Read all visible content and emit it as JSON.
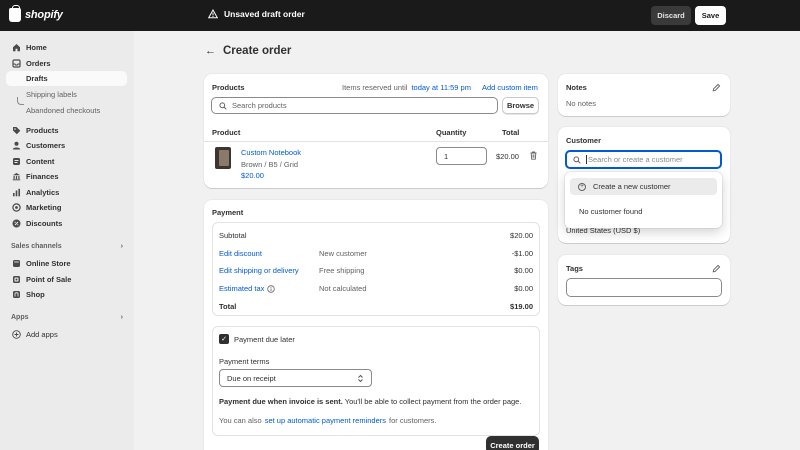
{
  "topbar": {
    "brand": "shopify",
    "status": "Unsaved draft order",
    "discard_label": "Discard",
    "save_label": "Save"
  },
  "sidebar": {
    "items": [
      {
        "label": "Home",
        "icon": "home-icon"
      },
      {
        "label": "Orders",
        "icon": "orders-icon"
      },
      {
        "label": "Products",
        "icon": "tag-icon"
      },
      {
        "label": "Customers",
        "icon": "person-icon"
      },
      {
        "label": "Content",
        "icon": "content-icon"
      },
      {
        "label": "Finances",
        "icon": "bank-icon"
      },
      {
        "label": "Analytics",
        "icon": "chart-icon"
      },
      {
        "label": "Marketing",
        "icon": "target-icon"
      },
      {
        "label": "Discounts",
        "icon": "discount-icon"
      }
    ],
    "orders_sub": [
      "Drafts",
      "Shipping labels",
      "Abandoned checkouts"
    ],
    "sales_channels_label": "Sales channels",
    "channels": [
      {
        "label": "Online Store",
        "icon": "store-icon"
      },
      {
        "label": "Point of Sale",
        "icon": "pos-icon"
      },
      {
        "label": "Shop",
        "icon": "shop-icon"
      }
    ],
    "apps_label": "Apps",
    "add_apps_label": "Add apps"
  },
  "page": {
    "title": "Create order"
  },
  "products": {
    "title": "Products",
    "reserved_prefix": "Items reserved until",
    "reserved_link": "today at 11:59 pm",
    "add_custom": "Add custom item",
    "search_placeholder": "Search products",
    "browse_label": "Browse",
    "col_product": "Product",
    "col_quantity": "Quantity",
    "col_total": "Total",
    "line": {
      "name": "Custom Notebook",
      "variant": "Brown / B5 / Grid",
      "price": "$20.00",
      "quantity": "1",
      "total": "$20.00"
    }
  },
  "payment": {
    "title": "Payment",
    "rows": [
      {
        "label": "Subtotal",
        "note": "",
        "value": "$20.00"
      },
      {
        "label": "Edit discount",
        "note": "New customer",
        "value": "-$1.00"
      },
      {
        "label": "Edit shipping or delivery",
        "note": "Free shipping",
        "value": "$0.00"
      },
      {
        "label": "Estimated tax",
        "note": "Not calculated",
        "value": "$0.00"
      },
      {
        "label": "Total",
        "note": "",
        "value": "$19.00"
      }
    ],
    "due_later_label": "Payment due later",
    "terms_label": "Payment terms",
    "terms_value": "Due on receipt",
    "due_bold": "Payment due when invoice is sent.",
    "due_text": "You'll be able to collect payment from the order page.",
    "reminder_prefix": "You can also",
    "reminder_link": "set up automatic payment reminders",
    "reminder_suffix": "for customers.",
    "create_label": "Create order"
  },
  "notes": {
    "title": "Notes",
    "empty": "No notes"
  },
  "customer": {
    "title": "Customer",
    "search_placeholder": "Search or create a customer",
    "create_new": "Create a new customer",
    "none_found": "No customer found",
    "market_text": "United States (USD $)"
  },
  "tags": {
    "title": "Tags"
  },
  "colors": {
    "topbar": "#1a1a1a",
    "link": "#005bd3",
    "primary_button": "#303030",
    "background": "#f1f1f1"
  }
}
